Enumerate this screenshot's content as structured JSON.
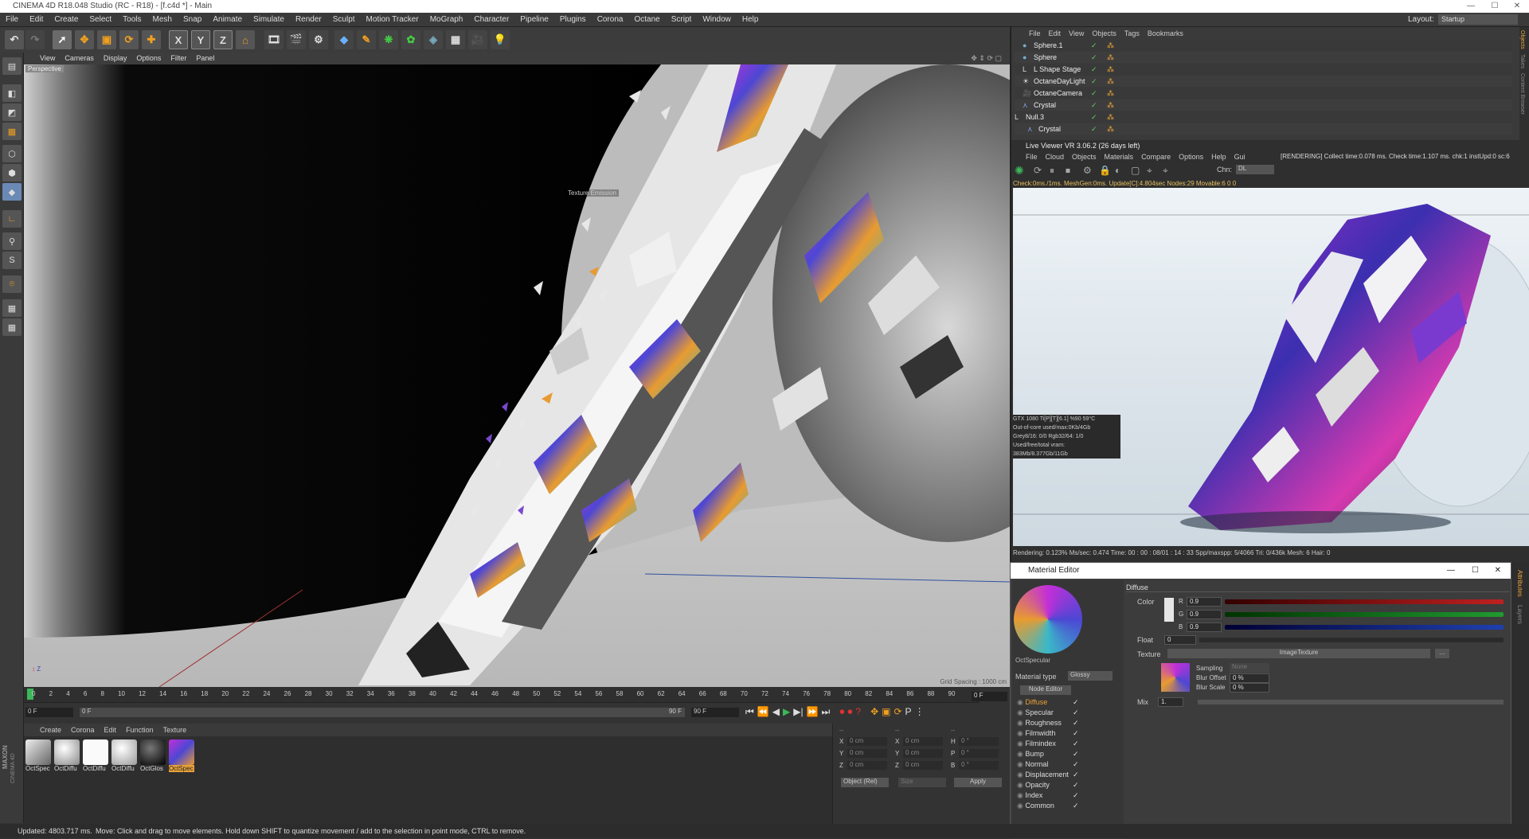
{
  "window": {
    "title": "CINEMA 4D R18.048 Studio (RC - R18) - [f.c4d *] - Main",
    "layout_label": "Layout:",
    "layout_value": "Startup"
  },
  "menu": [
    "File",
    "Edit",
    "Create",
    "Select",
    "Tools",
    "Mesh",
    "Snap",
    "Animate",
    "Simulate",
    "Render",
    "Sculpt",
    "Motion Tracker",
    "MoGraph",
    "Character",
    "Pipeline",
    "Plugins",
    "Corona",
    "Octane",
    "Script",
    "Window",
    "Help"
  ],
  "toolbar": {
    "axis": [
      "X",
      "Y",
      "Z"
    ]
  },
  "viewport": {
    "menu": [
      "View",
      "Cameras",
      "Display",
      "Options",
      "Filter",
      "Panel"
    ],
    "label": "Perspective",
    "tooltip": "Texture Emission",
    "grid": "Grid Spacing : 1000 cm"
  },
  "timeline": {
    "ticks": [
      "0",
      "2",
      "4",
      "6",
      "8",
      "10",
      "12",
      "14",
      "16",
      "18",
      "20",
      "22",
      "24",
      "26",
      "28",
      "30",
      "32",
      "34",
      "36",
      "38",
      "40",
      "42",
      "44",
      "46",
      "48",
      "50",
      "52",
      "54",
      "56",
      "58",
      "60",
      "62",
      "64",
      "66",
      "68",
      "70",
      "72",
      "74",
      "76",
      "78",
      "80",
      "82",
      "84",
      "86",
      "88",
      "90"
    ],
    "frame_end": "0 F",
    "start": "0 F",
    "cur": "0 F",
    "end": "90 F",
    "end2": "90 F"
  },
  "matmgr": {
    "menu": [
      "Create",
      "Corona",
      "Edit",
      "Function",
      "Texture"
    ],
    "materials": [
      "OctSpec",
      "OctDiffu",
      "OctDiffu",
      "OctDiffu",
      "OctGlos",
      "OctSpec"
    ]
  },
  "coords": {
    "cols": [
      "--",
      "--",
      "--"
    ],
    "rows": [
      [
        "X",
        "0 cm",
        "X",
        "0 cm",
        "H",
        "0 °"
      ],
      [
        "Y",
        "0 cm",
        "Y",
        "0 cm",
        "P",
        "0 °"
      ],
      [
        "Z",
        "0 cm",
        "Z",
        "0 cm",
        "B",
        "0 °"
      ]
    ],
    "mode": "Object (Rel)",
    "size": "Size",
    "apply": "Apply"
  },
  "status": {
    "left": "Updated: 4803.717 ms.",
    "text": "Move: Click and drag to move elements. Hold down SHIFT to quantize movement / add to the selection in point mode, CTRL to remove."
  },
  "objmgr": {
    "menu": [
      "File",
      "Edit",
      "View",
      "Objects",
      "Tags",
      "Bookmarks"
    ],
    "objects": [
      "Sphere.1",
      "Sphere",
      "L Shape Stage",
      "OctaneDayLight",
      "OctaneCamera",
      "Crystal",
      "Null.3",
      "Crystal"
    ],
    "side_tabs": [
      "Objects",
      "Takes",
      "Content Browser"
    ]
  },
  "liveviewer": {
    "title": "Live Viewer VR 3.06.2 (26 days left)",
    "menu": [
      "File",
      "Cloud",
      "Objects",
      "Materials",
      "Compare",
      "Options",
      "Help",
      "Gui"
    ],
    "rendering": "[RENDERING] Collect time:0.078 ms.  Check time:1.107 ms.  chk:1  instUpd:0  sc:6",
    "chn_label": "Chn:",
    "chn_value": "DL",
    "check": "Check:0ms./1ms. MeshGen:0ms. Update[C]:4.804sec Nodes:29 Movable:6  0 0",
    "gpu": "GTX 1080 Ti[P][T][6.1]       %90      59°C",
    "outofcore": "Out-of-core used/max:0Kb/4Gb",
    "grey": "Grey8/16: 0/0          Rgb32/64: 1/0",
    "vram": "Used/free/total vram: 383Mb/8.377Gb/11Gb",
    "bottom": "Rendering: 0.123%   Ms/sec: 0.474   Time: 00 : 00 : 08/01 : 14 : 33   Spp/maxspp: 5/4066     Tri: 0/436k   Mesh: 6   Hair: 0"
  },
  "mateditor": {
    "title": "Material Editor",
    "mat_name": "OctSpecular",
    "material_type_label": "Material type",
    "material_type": "Glossy",
    "node_editor": "Node Editor",
    "channels": [
      "Diffuse",
      "Specular",
      "Roughness",
      "Filmwidth",
      "Filmindex",
      "Bump",
      "Normal",
      "Displacement",
      "Opacity",
      "Index",
      "Common"
    ],
    "section": "Diffuse",
    "color_label": "Color",
    "r_label": "R",
    "r": "0.9",
    "g_label": "G",
    "g": "0.9",
    "b_label": "B",
    "b": "0.9",
    "float_label": "Float",
    "float": "0",
    "texture_label": "Texture",
    "texture": "ImageTexture",
    "sampling_label": "Sampling",
    "sampling": "None",
    "blur_offset_label": "Blur Offset",
    "blur_offset": "0 %",
    "blur_scale_label": "Blur Scale",
    "blur_scale": "0 %",
    "mix_label": "Mix",
    "mix": "1.",
    "side_tabs": [
      "Attributes",
      "Layers"
    ],
    "colors": {
      "active_channel": "#e8a23a",
      "red": "#c02020",
      "green": "#1f9a30",
      "blue": "#1f3fb0"
    }
  },
  "maxon": {
    "brand": "MAXON",
    "product": "CINEMA 4D"
  }
}
